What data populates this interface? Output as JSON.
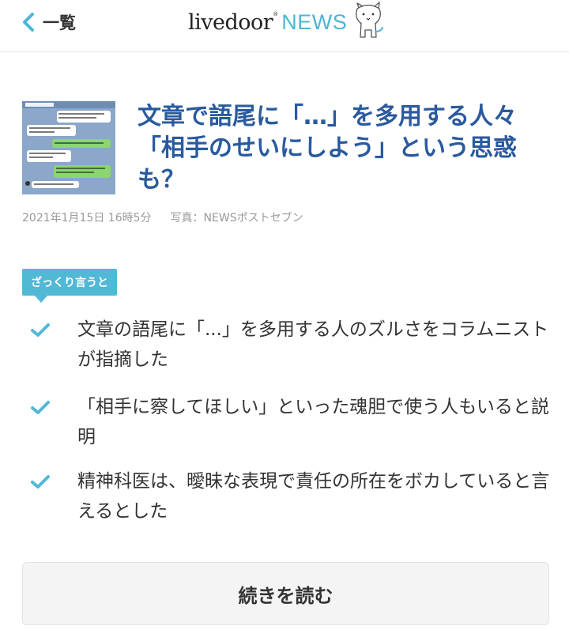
{
  "header": {
    "back_label": "一覧",
    "logo_live": "livedoor",
    "logo_reg": "®",
    "logo_news": "NEWS"
  },
  "article": {
    "title": "文章で語尾に「…」を多用する人々 「相手のせいにしよう」という思惑も？",
    "date": "2021年1月15日 16時5分",
    "credit": "写真：NEWSポストセブン"
  },
  "summary": {
    "tag_label": "ざっくり言うと",
    "points": [
      "文章の語尾に「...」を多用する人のズルさをコラムニストが指摘した",
      "「相手に察してほしい」といった魂胆で使う人もいると説明",
      "精神科医は、曖昧な表現で責任の所在をボカしていると言えるとした"
    ]
  },
  "read_more_label": "続きを読む",
  "colors": {
    "accent": "#51b8d6",
    "title": "#2a5a9e",
    "logo_news": "#4cb5d6"
  },
  "icons": [
    "chevron-left-icon",
    "mascot-dog-icon",
    "check-icon"
  ]
}
